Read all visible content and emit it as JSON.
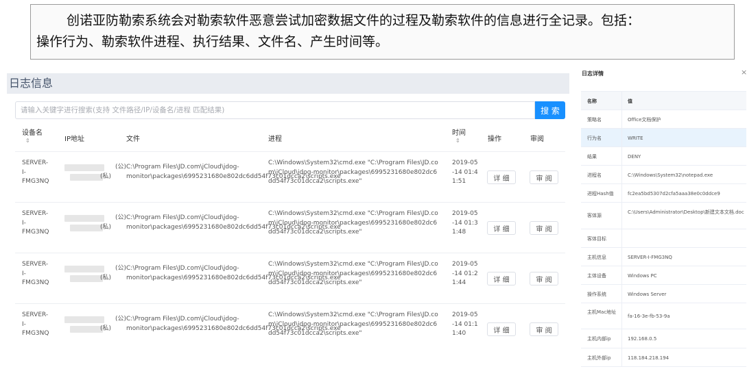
{
  "caption": {
    "line1": "创诺亚防勒索系统会对勒索软件恶意尝试加密数据文件的过程及勒索软件的信息进行全记录。包括：",
    "line2": "操作行为、勒索软件进程、执行结果、文件名、产生时间等。"
  },
  "log": {
    "title": "日志信息",
    "search_placeholder": "请输入关键字进行搜索(支持 文件路径/IP/设备名/进程 匹配结果)",
    "search_label": "搜 索",
    "columns": {
      "device": "设备名",
      "ip": "IP地址",
      "file": "文件",
      "process": "进程",
      "time": "时间",
      "action": "操作",
      "review": "审阅"
    },
    "sort_icon": "⇕",
    "rows": [
      {
        "device": "SERVER-I-FMG3NQ",
        "ip_public_tag": "(公)",
        "ip_private_tag": "(私)",
        "file": "C:\\Program Files\\JD.com\\jCloud\\jdog-monitor\\packages\\6995231680e802dc6dd54f73c01dcca2\\scripts.exe",
        "process": "C:\\Windows\\System32\\cmd.exe \"C:\\Program Files\\JD.com\\jCloud\\jdog-monitor\\packages\\6995231680e802dc6dd54f73c01dcca2\\scripts.exe\"",
        "time": "2019-05-14 01:41:51",
        "detail_label": "详 细",
        "review_label": "审 阅"
      },
      {
        "device": "SERVER-I-FMG3NQ",
        "ip_public_tag": "(公)",
        "ip_private_tag": "(私)",
        "file": "C:\\Program Files\\JD.com\\jCloud\\jdog-monitor\\packages\\6995231680e802dc6dd54f73c01dcca2\\scripts.exe",
        "process": "C:\\Windows\\System32\\cmd.exe \"C:\\Program Files\\JD.com\\jCloud\\jdog-monitor\\packages\\6995231680e802dc6dd54f73c01dcca2\\scripts.exe\"",
        "time": "2019-05-14 01:31:48",
        "detail_label": "详 细",
        "review_label": "审 阅"
      },
      {
        "device": "SERVER-I-FMG3NQ",
        "ip_public_tag": "(公)",
        "ip_private_tag": "(私)",
        "file": "C:\\Program Files\\JD.com\\jCloud\\jdog-monitor\\packages\\6995231680e802dc6dd54f73c01dcca2\\scripts.exe",
        "process": "C:\\Windows\\System32\\cmd.exe \"C:\\Program Files\\JD.com\\jCloud\\jdog-monitor\\packages\\6995231680e802dc6dd54f73c01dcca2\\scripts.exe\"",
        "time": "2019-05-14 01:21:44",
        "detail_label": "详 细",
        "review_label": "审 阅"
      },
      {
        "device": "SERVER-I-FMG3NQ",
        "ip_public_tag": "(公)",
        "ip_private_tag": "(私)",
        "file": "C:\\Program Files\\JD.com\\jCloud\\jdog-monitor\\packages\\6995231680e802dc6dd54f73c01dcca2\\scripts.exe",
        "process": "C:\\Windows\\System32\\cmd.exe \"C:\\Program Files\\JD.com\\jCloud\\jdog-monitor\\packages\\6995231680e802dc6dd54f73c01dcca2\\scripts.exe\"",
        "time": "2019-05-14 01:11:40",
        "detail_label": "详 细",
        "review_label": "审 阅"
      }
    ]
  },
  "detail": {
    "title": "日志详情",
    "close_icon": "×",
    "head": {
      "key": "名称",
      "value": "值"
    },
    "items": [
      {
        "key": "策略名",
        "value": "Office文档保护"
      },
      {
        "key": "行为名",
        "value": "WRITE"
      },
      {
        "key": "结果",
        "value": "DENY"
      },
      {
        "key": "进程名",
        "value": "C:\\Windows\\System32\\notepad.exe"
      },
      {
        "key": "进程Hash值",
        "value": "fc2ea5bd5307d2cfa5aaa38e0c0ddce9"
      },
      {
        "key": "客体源",
        "value": "C:\\Users\\Administrator\\Desktop\\新建文本文档.doc"
      },
      {
        "key": "客体目标",
        "value": ""
      },
      {
        "key": "主机信息",
        "value": "SERVER-I-FMG3NQ"
      },
      {
        "key": "主体设备",
        "value": "Windows PC"
      },
      {
        "key": "操作系统",
        "value": "Windows Server"
      },
      {
        "key": "主机Mac地址",
        "value": "fa-16-3e-fb-53-9a"
      },
      {
        "key": "主机内部ip",
        "value": "192.168.0.5"
      },
      {
        "key": "主机外部ip",
        "value": "118.184.218.194"
      }
    ]
  },
  "colors": {
    "accent": "#1890ff",
    "header_bg": "#e9ecf1",
    "highlight_row": "#e8f3fd"
  }
}
